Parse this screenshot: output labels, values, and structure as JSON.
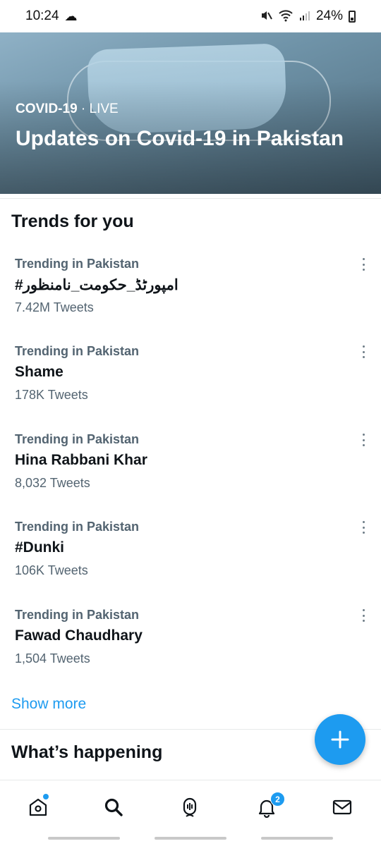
{
  "status_bar": {
    "time": "10:24",
    "battery": "24%"
  },
  "hero": {
    "category": "COVID-19",
    "separator": " · ",
    "live_label": "LIVE",
    "title": "Updates on Covid-19 in Pakistan"
  },
  "trends_section": {
    "title": "Trends for you",
    "items": [
      {
        "context": "Trending in Pakistan",
        "name": "#امپورٹڈ_حکومت_نامنظور",
        "count": "7.42M Tweets"
      },
      {
        "context": "Trending in Pakistan",
        "name": "Shame",
        "count": "178K Tweets"
      },
      {
        "context": "Trending in Pakistan",
        "name": "Hina Rabbani Khar",
        "count": "8,032 Tweets"
      },
      {
        "context": "Trending in Pakistan",
        "name": "#Dunki",
        "count": "106K Tweets"
      },
      {
        "context": "Trending in Pakistan",
        "name": "Fawad Chaudhary",
        "count": "1,504 Tweets"
      }
    ],
    "show_more": "Show more"
  },
  "whats_happening": {
    "title": "What’s happening"
  },
  "bottom_nav": {
    "notifications_count": "2",
    "icons": [
      "home-icon",
      "search-icon",
      "spaces-icon",
      "notifications-icon",
      "messages-icon"
    ]
  },
  "colors": {
    "accent": "#1d9bf0",
    "secondary_text": "#536471",
    "primary_text": "#0f1419"
  }
}
